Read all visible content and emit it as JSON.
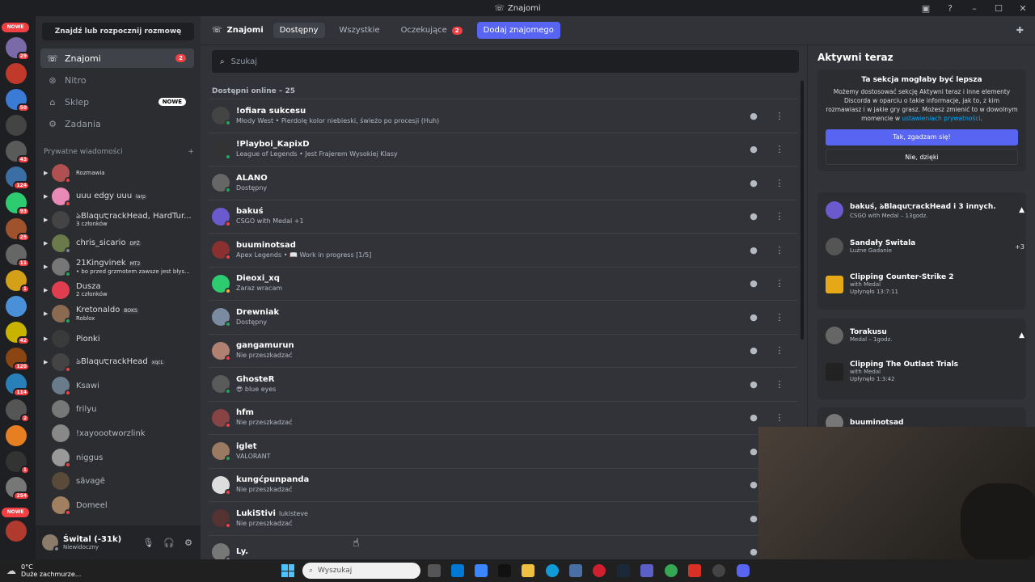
{
  "window": {
    "title": "Znajomi"
  },
  "servers": {
    "nowe_label": "NOWE",
    "badges": [
      "29",
      "",
      "50",
      "",
      "43",
      "124",
      "93",
      "25",
      "11",
      "1",
      "",
      "42",
      "120",
      "114",
      "2",
      "",
      "1",
      "254"
    ]
  },
  "sidebar": {
    "search_label": "Znajdź lub rozpocznij rozmowę",
    "nav": [
      {
        "label": "Znajomi",
        "count": "2"
      },
      {
        "label": "Nitro"
      },
      {
        "label": "Sklep",
        "badge": "NOWE"
      },
      {
        "label": "Zadania"
      }
    ],
    "dm_header": "Prywatne wiadomości",
    "dm_add": "+",
    "dms": [
      {
        "name": "",
        "sub": "Rozmawia"
      },
      {
        "name": "uuu edgy uuu",
        "tag": "larp",
        "sub": ""
      },
      {
        "name": "ঌBlaqu੮rackHead, HardTur...",
        "sub": "3 członków"
      },
      {
        "name": "chris_sicario",
        "tag": "DPŽ",
        "sub": ""
      },
      {
        "name": "21Kingvinek",
        "tag": "MT2",
        "sub": "• bo przed grzmotem zawsze jest błys..."
      },
      {
        "name": "Dusza",
        "sub": "2 członków"
      },
      {
        "name": "Kretonaldo",
        "tag": "BOKS",
        "sub": "Roblox"
      },
      {
        "name": "Pionki",
        "sub": ""
      },
      {
        "name": "ঌBlaqu੮rackHead",
        "tag": "xqcL",
        "sub": ""
      },
      {
        "name": "Ksawi",
        "sub": ""
      },
      {
        "name": "frilyu",
        "sub": ""
      },
      {
        "name": "!xayoootworzlink",
        "sub": ""
      },
      {
        "name": "niggus",
        "sub": ""
      },
      {
        "name": "sãvagẽ",
        "sub": ""
      },
      {
        "name": "Domeel",
        "sub": ""
      }
    ]
  },
  "user": {
    "name": "Śwital (-31k)",
    "status": "Niewidoczny"
  },
  "topbar": {
    "title": "Znajomi",
    "tabs": [
      "Dostępny",
      "Wszystkie",
      "Oczekujące"
    ],
    "pending_count": "2",
    "add_friend": "Dodaj znajomego"
  },
  "search": {
    "placeholder": "Szukaj"
  },
  "online_header": "Dostępni online – 25",
  "friends": [
    {
      "name": "!ofiara sukcesu",
      "sub": "Młody West • Pierdolę kolor niebieski, świeżo po procesji (Huh)"
    },
    {
      "name": "!Playboi_KapixD",
      "sub": "League of Legends • Jest Frajerem Wysokiej Klasy"
    },
    {
      "name": "ALANO",
      "sub": "Dostępny"
    },
    {
      "name": "bakuś",
      "sub": "CSGO with Medal +1"
    },
    {
      "name": "buuminotsad",
      "sub": "Apex Legends • 📖 Work in progress [1/5]"
    },
    {
      "name": "Dieoxi_xq",
      "sub": "Zaraz wracam"
    },
    {
      "name": "Drewniak",
      "sub": "Dostępny"
    },
    {
      "name": "gangamurun",
      "sub": "Nie przeszkadzać"
    },
    {
      "name": "GhosteR",
      "sub": "😎 blue eyes"
    },
    {
      "name": "hfm",
      "sub": "Nie przeszkadzać"
    },
    {
      "name": "iglet",
      "sub": "VALORANT"
    },
    {
      "name": "kungćpunpanda",
      "sub": "Nie przeszkadzać"
    },
    {
      "name": "LukiStivi",
      "tag": "lukisteve",
      "sub": "Nie przeszkadzać"
    },
    {
      "name": "Ly.",
      "sub": ""
    }
  ],
  "active_now": {
    "title": "Aktywni teraz",
    "card_title": "Ta sekcja mogłaby być lepsza",
    "card_text": "Możemy dostosować sekcję Aktywni teraz i inne elementy Discorda w oparciu o takie informacje, jak to, z kim rozmawiasz i w jakie gry grasz. Możesz zmienić to w dowolnym momencie w",
    "card_link": "ustawieniach prywatności",
    "yes": "Tak, zgadzam się!",
    "no": "Nie, dzięki",
    "a1_title": "bakuś, ঌBlaqu੮rackHead i 3 innych...",
    "a1_sub": "CSGO with Medal – 13godz.",
    "a1_row1": "Sandały Świtala",
    "a1_row1_sub": "Luźne Gadanie",
    "a1_more": "+3",
    "a1_row2": "Clipping Counter-Strike 2",
    "a1_row2_sub": "with Medal",
    "a1_row2_time": "Upłynęło 13:7:11",
    "a2_title": "Torakusu",
    "a2_sub": "Medal – 1godz.",
    "a2_row": "Clipping The Outlast Trials",
    "a2_row_sub": "with Medal",
    "a2_row_time": "Upłynęło 1:3:42",
    "a3_title": "buuminotsad"
  },
  "taskbar": {
    "temp": "0°C",
    "weather": "Duże zachmurze...",
    "search": "Wyszukaj"
  }
}
